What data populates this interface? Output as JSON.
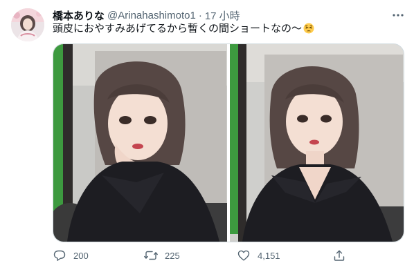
{
  "tweet": {
    "display_name": "橋本ありな",
    "handle": "@Arinahashimoto1",
    "separator": "·",
    "time": "17 小時",
    "text": "頭皮におやすみあげてるから暫くの間ショートなの〜",
    "emoji": "tired-face-emoji"
  },
  "actions": {
    "reply_count": "200",
    "retweet_count": "225",
    "like_count": "4,151"
  },
  "colors": {
    "secondary_text": "#536471",
    "border": "#cfd9de",
    "icon": "#536471"
  }
}
